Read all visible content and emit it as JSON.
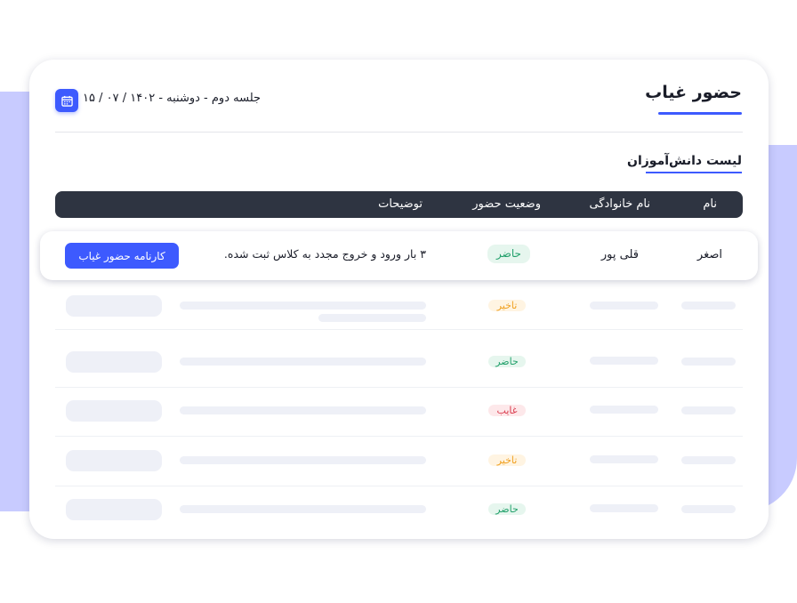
{
  "page": {
    "title": "حضور غیاب"
  },
  "session": {
    "info": "جلسه دوم  -  دوشنبه  -  ۱۴۰۲ / ۰۷ / ۱۵"
  },
  "list": {
    "title": "لیست دانش‌آموزان"
  },
  "table": {
    "headers": {
      "name": "نام",
      "family": "نام خانوادگی",
      "status": "وضعیت حضور",
      "notes": "توضیحات"
    },
    "active_row": {
      "name": "اصغر",
      "family": "قلی پور",
      "status": "حاضر",
      "notes": "۳ بار ورود و خروج مجدد به کلاس ثبت شده.",
      "action": "کارنامه حضور غیاب"
    },
    "rows": [
      {
        "status": "تاخیر",
        "status_type": "late"
      },
      {
        "status": "حاضر",
        "status_type": "present"
      },
      {
        "status": "غایب",
        "status_type": "absent"
      },
      {
        "status": "تاخیر",
        "status_type": "late"
      },
      {
        "status": "حاضر",
        "status_type": "present"
      }
    ]
  },
  "colors": {
    "accent": "#3d5afe",
    "header_bg": "#2e3441",
    "background_shape": "#c8cbff"
  },
  "icons": {
    "date": "calendar-icon"
  }
}
